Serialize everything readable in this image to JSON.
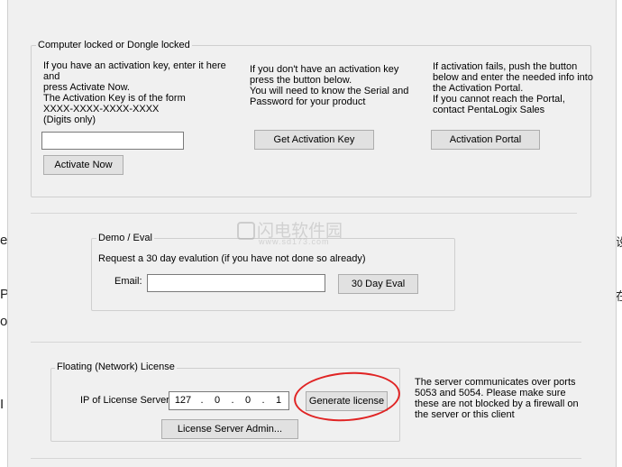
{
  "locked": {
    "legend": "Computer locked or Dongle locked",
    "col1_text": "If you have an activation key, enter it here and\npress Activate Now.\nThe Activation Key is of the form\nXXXX-XXXX-XXXX-XXXX\n(Digits only)",
    "activation_key_value": "",
    "activate_now_label": "Activate Now",
    "col2_text": "If you don't have an activation key\npress the button below.\nYou will need to know the Serial and\nPassword for your product",
    "get_activation_key_label": "Get Activation Key",
    "col3_text": "If activation fails, push the button\nbelow and enter the needed info into\nthe Activation Portal.\nIf you cannot reach the Portal,\ncontact PentaLogix Sales",
    "activation_portal_label": "Activation Portal"
  },
  "demo": {
    "legend": "Demo / Eval",
    "text": "Request a 30 day evalution (if you have not done so already)",
    "email_label": "Email:",
    "email_value": "",
    "eval_button_label": "30 Day Eval"
  },
  "floating": {
    "legend": "Floating (Network) License",
    "ip_label": "IP of License Server:",
    "ip": [
      "127",
      "0",
      "0",
      "1"
    ],
    "ip_dot": ".",
    "generate_label": "Generate license",
    "admin_label": "License Server Admin...",
    "note": "The server communicates over ports\n5053 and 5054. Please make sure\nthese are not blocked by a firewall on\nthe server or this client"
  },
  "background": {
    "left_fragments": [
      "e",
      "P",
      "o",
      "I"
    ],
    "right_fragments": [
      "设",
      "在"
    ]
  },
  "watermark": {
    "main": "闪电软件园",
    "url": "www.sd173.com"
  },
  "annotation": {
    "color": "#e02424"
  }
}
